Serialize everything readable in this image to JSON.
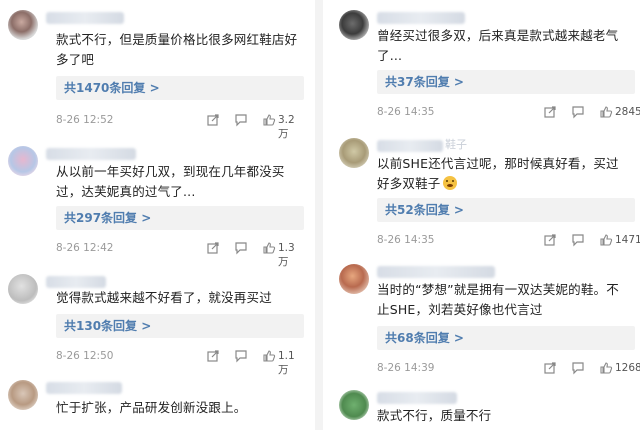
{
  "left": [
    {
      "text": "款式不行，但是质量价格比很多网红鞋店好多了吧",
      "replies": "共1470条回复 >",
      "time": "8-26 12:52",
      "likes": "3.2万"
    },
    {
      "text": "从以前一年买好几双，到现在几年都没买过，达芙妮真的过气了...",
      "replies": "共297条回复 >",
      "time": "8-26 12:42",
      "likes": "1.3万"
    },
    {
      "text": "觉得款式越来越不好看了，就没再买过",
      "replies": "共130条回复 >",
      "time": "8-26 12:50",
      "likes": "1.1万"
    },
    {
      "text": "忙于扩张，产品研发创新没跟上。"
    }
  ],
  "right": [
    {
      "text": "曾经买过很多双，后来真是款式越来越老气了...",
      "replies": "共37条回复 >",
      "time": "8-26 14:35",
      "likes": "2845"
    },
    {
      "username_tail": "鞋子",
      "text": "以前SHE还代言过呢，那时候真好看，买过好多双鞋子",
      "replies": "共52条回复 >",
      "time": "8-26 14:35",
      "likes": "1471"
    },
    {
      "text": "当时的“梦想”就是拥有一双达芙妮的鞋。不止SHE，刘若英好像也代言过",
      "replies": "共68条回复 >",
      "time": "8-26 14:39",
      "likes": "1268"
    },
    {
      "text": "款式不行，质量不行"
    }
  ],
  "icons": [
    "share-icon",
    "comment-icon",
    "like-icon"
  ]
}
